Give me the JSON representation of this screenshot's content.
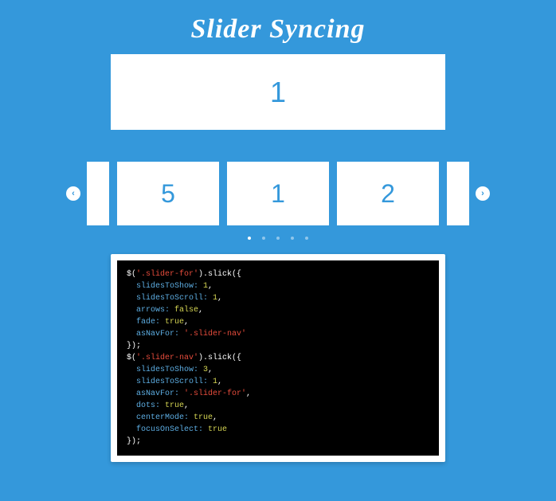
{
  "title": "Slider Syncing",
  "main_slide": "1",
  "nav_slides": [
    "5",
    "1",
    "2"
  ],
  "nav_arrows": {
    "prev": "‹",
    "next": "›"
  },
  "dots_count": 5,
  "active_dot": 0,
  "code": {
    "l1_a": "$(",
    "l1_sel": "'.slider-for'",
    "l1_b": ").slick({",
    "l2_k": "  slidesToShow: ",
    "l2_v": "1",
    "l2_p": ",",
    "l3_k": "  slidesToScroll: ",
    "l3_v": "1",
    "l3_p": ",",
    "l4_k": "  arrows: ",
    "l4_v": "false",
    "l4_p": ",",
    "l5_k": "  fade: ",
    "l5_v": "true",
    "l5_p": ",",
    "l6_k": "  asNavFor: ",
    "l6_v": "'.slider-nav'",
    "l7": "});",
    "l8_a": "$(",
    "l8_sel": "'.slider-nav'",
    "l8_b": ").slick({",
    "l9_k": "  slidesToShow: ",
    "l9_v": "3",
    "l9_p": ",",
    "l10_k": "  slidesToScroll: ",
    "l10_v": "1",
    "l10_p": ",",
    "l11_k": "  asNavFor: ",
    "l11_v": "'.slider-for'",
    "l11_p": ",",
    "l12_k": "  dots: ",
    "l12_v": "true",
    "l12_p": ",",
    "l13_k": "  centerMode: ",
    "l13_v": "true",
    "l13_p": ",",
    "l14_k": "  focusOnSelect: ",
    "l14_v": "true",
    "l15": "});"
  }
}
